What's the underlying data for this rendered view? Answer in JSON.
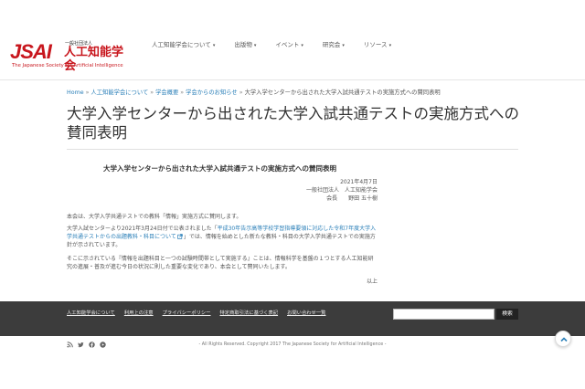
{
  "header": {
    "logo_mark": "JSAI",
    "logo_org": "一般社団法人",
    "logo_name": "人工知能学会",
    "logo_en": "The Japanese Society for Artificial Intelligence"
  },
  "nav": {
    "items": [
      {
        "label": "人工知能学会について"
      },
      {
        "label": "出版物"
      },
      {
        "label": "イベント"
      },
      {
        "label": "研究会"
      },
      {
        "label": "リソース"
      }
    ]
  },
  "breadcrumb": {
    "home": "Home",
    "items": [
      "人工知能学会について",
      "学会概要",
      "学会からのお知らせ"
    ],
    "current": "大学入学センターから出された大学入試共通テストの実施方式への賛同表明"
  },
  "page_title": "大学入学センターから出された大学入試共通テストの実施方式への賛同表明",
  "article": {
    "heading": "大学入学センターから出された大学入試共通テストの実施方式への賛同表明",
    "date": "2021年4月7日",
    "org_line1": "一般社団法人　人工知能学会",
    "org_line2": "会長　　野田 五十樹",
    "p1": "本会は、大学入学共通テストでの教科「情報」実施方式に賛同します。",
    "p2_before": "大学入試センターより2021年3月24日付で公表されました「",
    "p2_link": "平成30年告示高等学校学習指導要領に対応した令和7年度大学入学共通テストからの出題教科・科目について",
    "p2_after": "」では、情報を始めとした新たな教科・科目の大学入学共通テストでの実施方針が示されています。",
    "p3": "そこに示されている『情報を出題科目と一つの試験時間帯として実施する』ことは、情報科学を基盤の１つとする人工知能研究の進展・普及が進む今日の状況に則した重要な変化であり、本会として賛同いたします。",
    "closing": "以上"
  },
  "footer": {
    "links": [
      "人工知能学会について",
      "利用上の注意",
      "プライバシーポリシー",
      "特定商取引法に基づく表記",
      "お問い合わせ一覧"
    ],
    "search_placeholder": "",
    "search_button": "検索"
  },
  "bottom": {
    "copyright": "- All Rights Reserved. Copyright 2017 The Japanese Society for Artificial Intelligence -",
    "social_icons": [
      "rss-icon",
      "twitter-icon",
      "facebook-icon",
      "youtube-icon"
    ]
  },
  "colors": {
    "brand_red": "#c8161d",
    "link_blue": "#2a7fb8",
    "footer_bg": "#3c3c3c"
  }
}
